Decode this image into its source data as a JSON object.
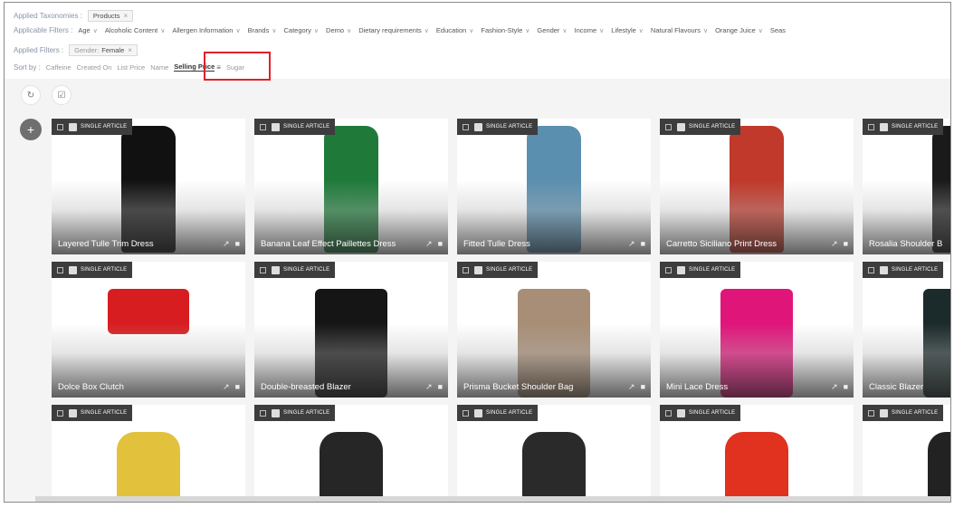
{
  "applied_taxonomies": {
    "label": "Applied Taxonomies :",
    "chips": [
      "Products"
    ]
  },
  "applicable_filters": {
    "label": "Applicable Filters :",
    "items": [
      "Age",
      "Alcoholic Content",
      "Allergen Information",
      "Brands",
      "Category",
      "Demo",
      "Dietary requirements",
      "Education",
      "Fashion-Style",
      "Gender",
      "Income",
      "Lifestyle",
      "Natural Flavours",
      "Orange Juice",
      "Seas"
    ]
  },
  "applied_filters": {
    "label": "Applied Filters :",
    "chip_key": "Gender:",
    "chip_value": "Female"
  },
  "sort": {
    "label": "Sort by :",
    "options": [
      "Caffeine",
      "Created On",
      "List Price",
      "Name"
    ],
    "active": "Selling Price",
    "after": "Sugar"
  },
  "badge_label": "SINGLE ARTICLE",
  "icons": {
    "refresh": "refresh-icon",
    "select_all": "checkbox-icon",
    "add": "plus-icon",
    "pin": "pin-icon",
    "delete": "trash-icon",
    "sort_direction": "sort-desc-icon"
  },
  "cards": [
    {
      "title": "Layered Tulle Trim Dress",
      "color": "#111111"
    },
    {
      "title": "Banana Leaf Effect Paillettes Dress",
      "color": "#1f7a3a"
    },
    {
      "title": "Fitted Tulle Dress",
      "color": "#5b8fb0"
    },
    {
      "title": "Carretto Siciliano Print Dress",
      "color": "#c0392b"
    },
    {
      "title": "Rosalia Shoulder B",
      "color": "#1a1a1a"
    },
    {
      "title": "Dolce Box Clutch",
      "color": "#d81d20"
    },
    {
      "title": "Double-breasted Blazer",
      "color": "#151515"
    },
    {
      "title": "Prisma Bucket Shoulder Bag",
      "color": "#a88e76"
    },
    {
      "title": "Mini Lace Dress",
      "color": "#e0157a"
    },
    {
      "title": "Classic Blazer",
      "color": "#1b2a2a"
    },
    {
      "title": "",
      "color": "#e2c13c"
    },
    {
      "title": "",
      "color": "#262626"
    },
    {
      "title": "",
      "color": "#2a2a2a"
    },
    {
      "title": "",
      "color": "#e0321e"
    },
    {
      "title": "",
      "color": "#222222"
    }
  ]
}
